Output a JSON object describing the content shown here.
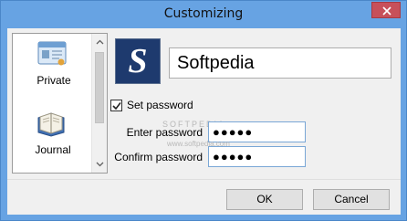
{
  "window": {
    "title": "Customizing"
  },
  "sidebar": {
    "items": [
      {
        "label": "Private",
        "icon": "private-profile-icon",
        "selected": true
      },
      {
        "label": "Journal",
        "icon": "journal-book-icon",
        "selected": false
      }
    ]
  },
  "profile": {
    "avatar_letter": "S",
    "name": "Softpedia"
  },
  "password": {
    "checkbox_label": "Set password",
    "checked": true,
    "enter_label": "Enter password",
    "enter_value": "●●●●●",
    "confirm_label": "Confirm password",
    "confirm_value": "●●●●●"
  },
  "buttons": {
    "ok": "OK",
    "cancel": "Cancel"
  },
  "watermark": {
    "line1": "SOFTPEDIA",
    "line2": "www.softpedia.com"
  },
  "colors": {
    "titlebar": "#67a3e3",
    "close": "#c7505a",
    "avatar_bg": "#1e3a6e",
    "input_border": "#7aa7d6"
  }
}
